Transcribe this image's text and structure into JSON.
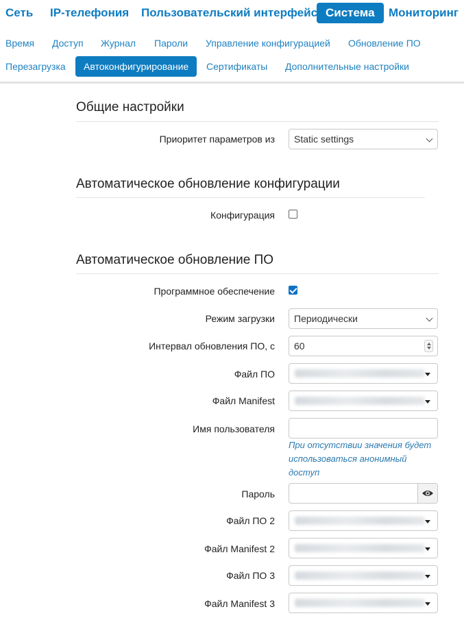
{
  "main_nav": [
    "Сеть",
    "IP-телефония",
    "Пользовательский интерфейс",
    "Система",
    "Мониторинг"
  ],
  "sub_nav_row1": [
    "Время",
    "Доступ",
    "Журнал",
    "Пароли",
    "Управление конфигурацией",
    "Обновление ПО"
  ],
  "sub_nav_row2": [
    "Перезагрузка",
    "Автоконфигурирование",
    "Сертификаты",
    "Дополнительные настройки"
  ],
  "general": {
    "title": "Общие настройки",
    "priority_label": "Приоритет параметров из",
    "priority_value": "Static settings"
  },
  "config_update": {
    "title": "Автоматическое обновление конфигурации",
    "config_label": "Конфигурация",
    "config_checked": false
  },
  "fw_update": {
    "title": "Автоматическое обновление ПО",
    "software_label": "Программное обеспечение",
    "software_checked": true,
    "mode_label": "Режим загрузки",
    "mode_value": "Периодически",
    "interval_label": "Интервал обновления ПО, с",
    "interval_value": "60",
    "file_label": "Файл ПО",
    "manifest_label": "Файл Manifest",
    "user_label": "Имя пользователя",
    "user_value": "",
    "user_hint": "При отсутствии значения будет использоваться анонимный доступ",
    "password_label": "Пароль",
    "file2_label": "Файл ПО 2",
    "manifest2_label": "Файл Manifest 2",
    "file3_label": "Файл ПО 3",
    "manifest3_label": "Файл Manifest 3"
  },
  "colors": {
    "accent": "#0e7cc1",
    "hint": "#2a7ab0",
    "divider": "#e3e3e3"
  }
}
